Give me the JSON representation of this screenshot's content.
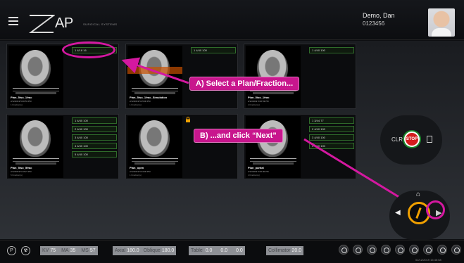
{
  "header": {
    "logo_text": "AP",
    "logo_sub": "SURGICAL SYSTEMS",
    "user_name": "Demo,   Dan",
    "user_id": "0123456"
  },
  "plans": [
    {
      "name": "Plan_5iso_1frac",
      "date": "2/12/2019 5:00:53 PM",
      "fractions_label": "1 Fraction(s)",
      "fractions": [
        "1  4/18  16"
      ],
      "locked": false
    },
    {
      "name": "Plan_5iso_1frac_Simulation",
      "date": "2/12/2019 5:25:00 PM",
      "fractions_label": "1 Fraction(s)",
      "fractions": [
        "1  4/40  100"
      ],
      "locked": false
    },
    {
      "name": "Plan_5iso_1frac",
      "date": "2/12/2019 5:00:53 PM",
      "fractions_label": "1 Fraction(s)",
      "fractions": [
        "1  4/40  100"
      ],
      "locked": false
    },
    {
      "name": "Plan_5iso_5frac",
      "date": "2/12/2019 5:18:27 PM",
      "fractions_label": "5 Fraction(s)",
      "fractions": [
        "1  4/40  100",
        "2  4/40  100",
        "3  4/40  100",
        "4  4/40  100",
        "5  4/40  100"
      ],
      "locked": false
    },
    {
      "name": "Plan_open",
      "date": "2/12/2019 5:04:00 PM",
      "fractions_label": "1 Fraction(s)",
      "fractions": [],
      "locked": true
    },
    {
      "name": "Plan_partial",
      "date": "2/12/2019 5:00:00 PM",
      "fractions_label": "4 Fraction(s)",
      "fractions": [
        "1  3/44  77",
        "2  4/40  100",
        "3  4/40  100",
        "4  4/40  100"
      ],
      "locked": false
    }
  ],
  "callouts": {
    "a": "A) Select a Plan/Fraction...",
    "b": "B) ...and click “Next”"
  },
  "controls": {
    "clr": "CLR",
    "stop": "STOP",
    "prev_glyph": "◀",
    "next_glyph": "▶",
    "home_glyph": "⌂"
  },
  "status": {
    "p_glyph": "P",
    "rad_glyph": "☢",
    "kv": "75",
    "ma": "35",
    "ms": "57",
    "axial": "180.0",
    "oblique": "180.0",
    "table_1": "0.0",
    "table_2": "0.0",
    "table_3": "0.0",
    "collimator": "20.0",
    "timestamp": "02/12/2019 15:45:58"
  },
  "labels": {
    "kv": "KV",
    "ma": "MA",
    "ms": "MS",
    "axial": "Axial",
    "oblique": "Oblique",
    "table": "Table",
    "collimator": "Collimator"
  },
  "colors": {
    "accent_magenta": "#c8168d",
    "stop_red": "#d51d1d",
    "go_green": "#1b8a2c",
    "wheel_orange": "#f0a000"
  }
}
